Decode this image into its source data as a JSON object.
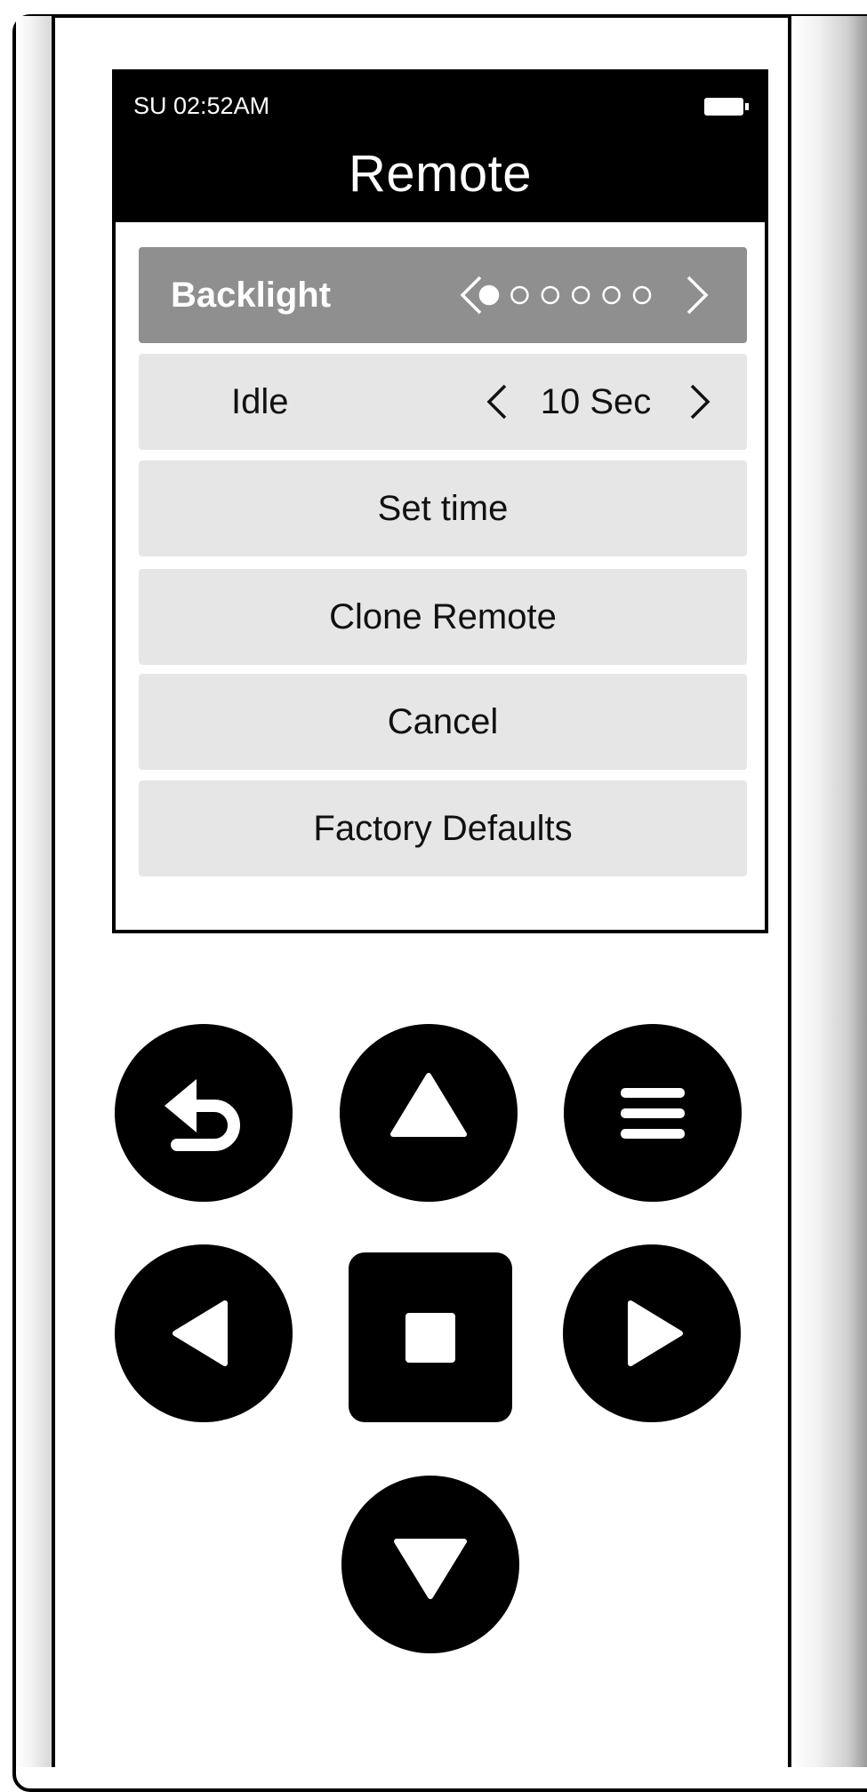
{
  "status": {
    "clock": "SU 02:52AM",
    "battery_icon": "battery-icon"
  },
  "screen": {
    "title": "Remote"
  },
  "menu": {
    "backlight": {
      "label": "Backlight",
      "level": 1,
      "max_level": 6
    },
    "idle": {
      "label": "Idle",
      "value": "10 Sec"
    },
    "set_time": "Set time",
    "clone_remote": "Clone Remote",
    "cancel": "Cancel",
    "factory_defaults": "Factory Defaults"
  },
  "buttons": {
    "back": "back-icon",
    "up": "up-arrow-icon",
    "menu": "menu-icon",
    "left": "left-arrow-icon",
    "ok": "ok-square-icon",
    "right": "right-arrow-icon",
    "down": "down-arrow-icon"
  }
}
